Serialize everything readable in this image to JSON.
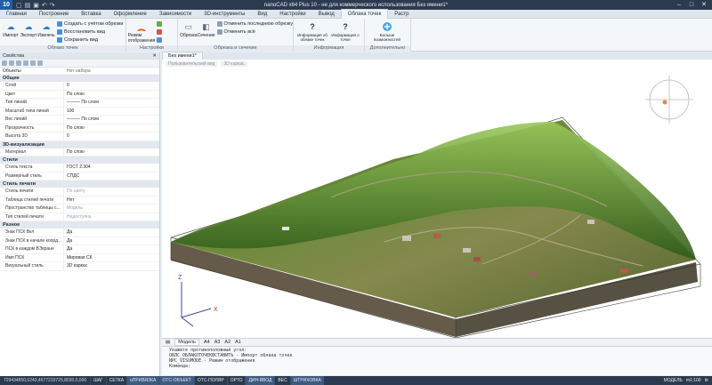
{
  "app": {
    "title": "nanoCAD x64 Plus 10 - не для коммерческого использования Без имени1*",
    "logo": "10"
  },
  "menu": {
    "tabs": [
      "Главная",
      "Построение",
      "Вставка",
      "Оформление",
      "Зависимости",
      "3D-инструменты",
      "Вид",
      "Настройки",
      "Вывод",
      "Облака точек",
      "Растр"
    ],
    "active": "Облака точек"
  },
  "ribbon": {
    "groups": [
      {
        "name": "Облако точек",
        "big": [
          "Импорт",
          "Экспорт",
          "Извлечь"
        ],
        "small": [
          "Создать с учётом обрезки",
          "Восстановить вид",
          "Сохранить вид"
        ]
      },
      {
        "name": "Настройки",
        "big": [
          "Режим отображения"
        ]
      },
      {
        "name": "Обрезка и сечение",
        "big": [
          "Обрезка",
          "Сечение"
        ],
        "small": [
          "Отменить последнюю обрезку",
          "Отменить всё"
        ]
      },
      {
        "name": "Информация",
        "big": [
          "Информация об облаке точек",
          "Информация о точке"
        ]
      },
      {
        "name": "Дополнительно",
        "big": [
          "Больше возможностей"
        ]
      }
    ]
  },
  "properties": {
    "title": "Свойства",
    "object_label": "Объекты",
    "object_value": "Нет набора",
    "sections": [
      {
        "name": "Общие",
        "rows": [
          {
            "name": "Слой",
            "value": "0"
          },
          {
            "name": "Цвет",
            "value": "По слою"
          },
          {
            "name": "Тип линий",
            "value": "——— По слою"
          },
          {
            "name": "Масштаб типа линий",
            "value": "100"
          },
          {
            "name": "Вес линий",
            "value": "——— По слою"
          },
          {
            "name": "Прозрачность",
            "value": "По слою"
          },
          {
            "name": "Высота 3D",
            "value": "0"
          }
        ]
      },
      {
        "name": "3D-визуализация",
        "rows": [
          {
            "name": "Материал",
            "value": "По слою"
          }
        ]
      },
      {
        "name": "Стили",
        "rows": [
          {
            "name": "Стиль текста",
            "value": "ГОСТ 2.304"
          },
          {
            "name": "Размерный стиль",
            "value": "СПДС"
          }
        ]
      },
      {
        "name": "Стиль печати",
        "rows": [
          {
            "name": "Стиль печати",
            "value": "По цвету",
            "muted": true
          },
          {
            "name": "Таблица стилей печати",
            "value": "Нет"
          },
          {
            "name": "Пространство таблицы с...",
            "value": "Модель",
            "muted": true
          },
          {
            "name": "Тип стилей печати",
            "value": "Недоступна",
            "muted": true
          }
        ]
      },
      {
        "name": "Разное",
        "rows": [
          {
            "name": "Знак ПСК Вкл",
            "value": "Да"
          },
          {
            "name": "Знак ПСК в начале коорд...",
            "value": "Да"
          },
          {
            "name": "ПСК в каждом ВЭкране",
            "value": "Да"
          },
          {
            "name": "Имя ПСК",
            "value": "Мировая СК"
          },
          {
            "name": "Визуальный стиль",
            "value": "3D каркас"
          }
        ]
      }
    ]
  },
  "document": {
    "tab": "Без имени1*",
    "viewport_flags": [
      "Пользовательский вид",
      "3D каркас"
    ]
  },
  "model_tabs": [
    "Модель",
    "A4",
    "A3",
    "A2",
    "A1"
  ],
  "command_lines": [
    "Укажите противоположный угол:",
    "ОБЛС_ОБЛАКОТОЧЕКВСТАВИТЬ - Импорт облака точек",
    "NPC_VISUMODE - Режим отображения",
    "Команда:"
  ],
  "status": {
    "coords": "729434850,0243,4677233725,8030,0,000",
    "buttons": [
      {
        "label": "ШАГ",
        "on": false
      },
      {
        "label": "СЕТКА",
        "on": false
      },
      {
        "label": "оПРИВЯЗКА",
        "on": true
      },
      {
        "label": "ОТС-ОБЪЕКТ",
        "on": true
      },
      {
        "label": "ОТС-ПОЛЯР",
        "on": false
      },
      {
        "label": "ОРТО",
        "on": false
      },
      {
        "label": "ДИН-ВВОД",
        "on": true
      },
      {
        "label": "ВЕС",
        "on": false
      },
      {
        "label": "ШТРИХОВКА",
        "on": true
      }
    ],
    "model_label": "МОДЕЛЬ",
    "scale": "m1:100"
  }
}
